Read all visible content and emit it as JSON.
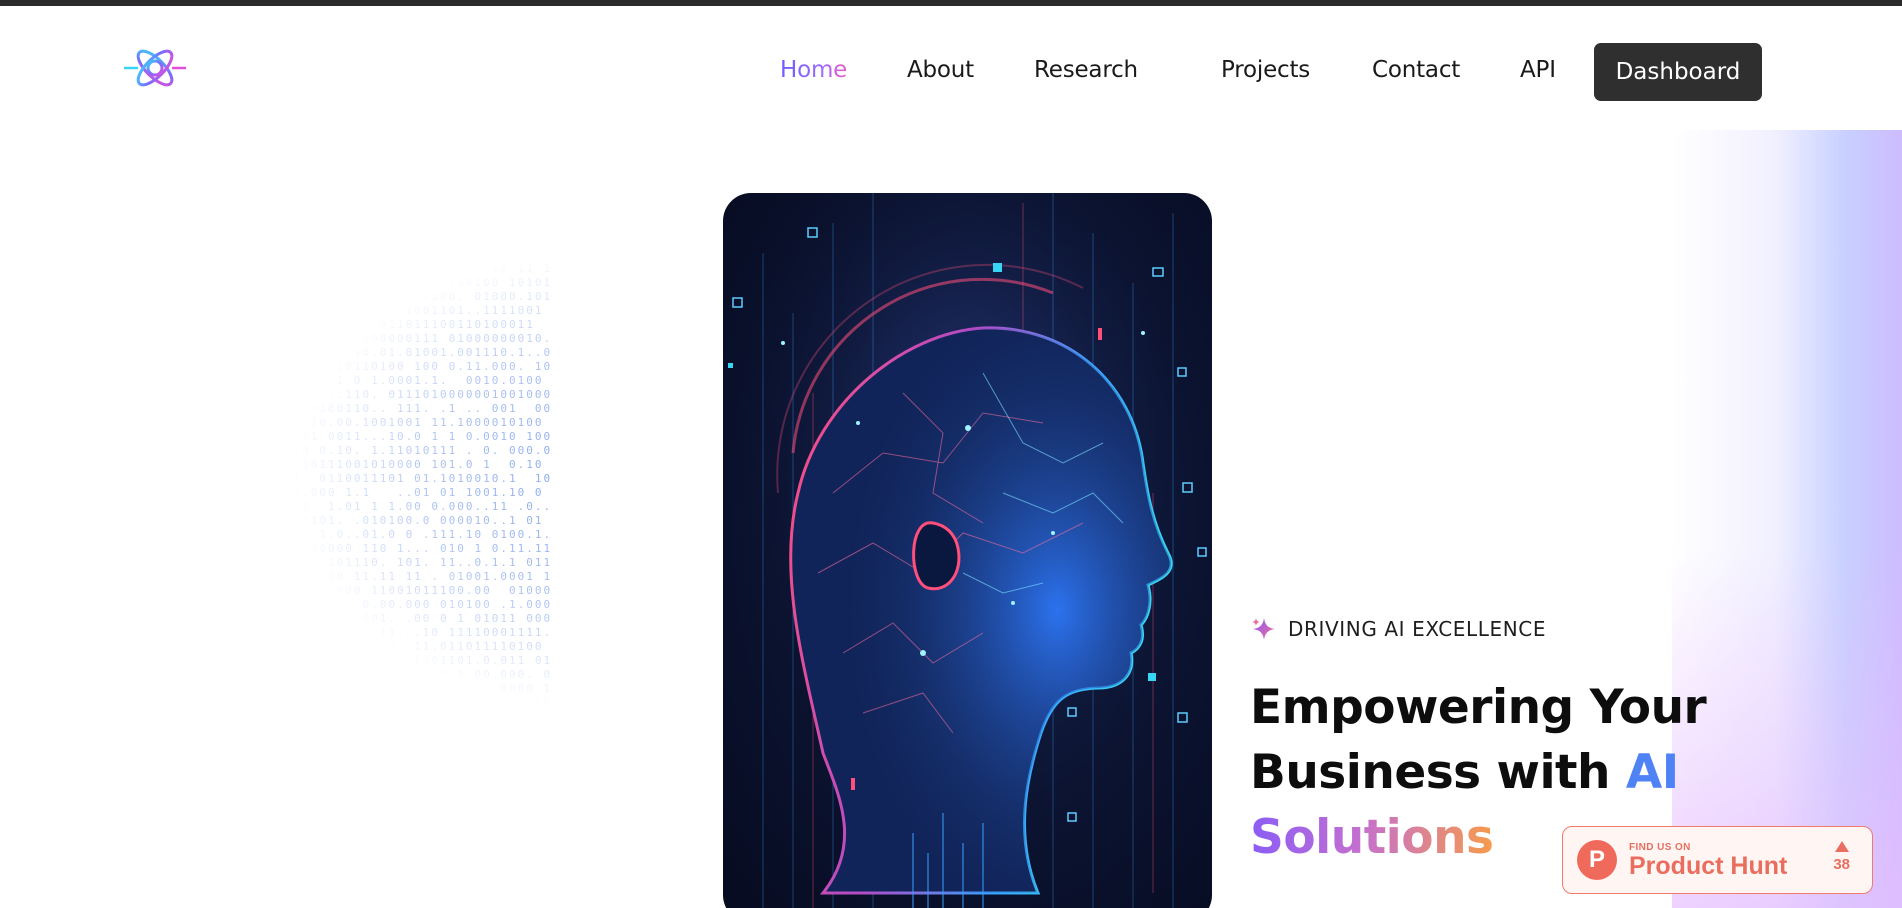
{
  "nav": {
    "home": "Home",
    "about": "About",
    "research": "Research",
    "projects": "Projects",
    "contact": "Contact",
    "api": "API",
    "dashboard": "Dashboard"
  },
  "hero": {
    "tagline": "DRIVING AI EXCELLENCE",
    "headline_part1": "Empowering Your",
    "headline_part2": "Business with ",
    "headline_ai": "AI",
    "headline_solutions": "Solutions"
  },
  "product_hunt": {
    "small": "FIND US ON",
    "big": "Product Hunt",
    "votes": "38"
  },
  "colors": {
    "accent_blue": "#4f83f5",
    "accent_purple": "#8b5cf6",
    "accent_orange": "#f79b4b",
    "dashboard_bg": "#2f2f2f",
    "product_hunt": "#ea6e5f"
  },
  "icons": {
    "logo": "atom-logo-icon",
    "tagline": "sparkle-icon",
    "product_hunt": "product-hunt-logo-icon",
    "upvote": "upvote-arrow-icon"
  }
}
